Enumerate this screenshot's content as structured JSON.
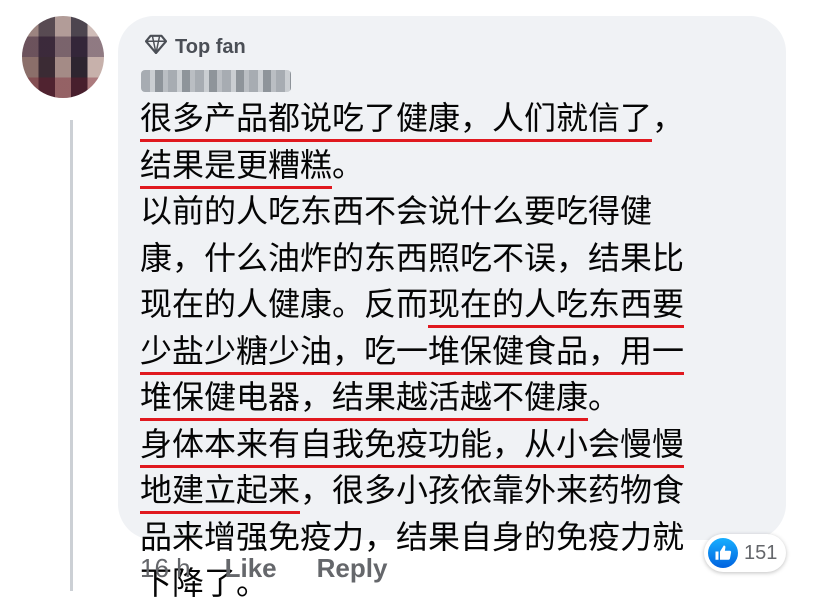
{
  "comment": {
    "badge_icon": "diamond-icon",
    "badge_label": "Top fan",
    "lines": [
      [
        {
          "t": "很多产品都说吃了健康，人们就信了",
          "u": true
        },
        {
          "t": "，",
          "u": false
        }
      ],
      [
        {
          "t": "结果是更糟糕",
          "u": true
        },
        {
          "t": "。",
          "u": false
        }
      ],
      [
        {
          "t": "以前的人吃东西不会说什么要吃得健",
          "u": false
        }
      ],
      [
        {
          "t": "康，什么油炸的东西照吃不误，结果比",
          "u": false
        }
      ],
      [
        {
          "t": "现在的人健康。反而",
          "u": false
        },
        {
          "t": "现在的人吃东西要",
          "u": true
        }
      ],
      [
        {
          "t": "少盐少糖少油，吃一堆保健食品，用一",
          "u": true
        }
      ],
      [
        {
          "t": "堆保健电器，结果越活越不健康",
          "u": true
        },
        {
          "t": "。",
          "u": false
        }
      ],
      [
        {
          "t": "身体本来有自我免疫功能，从小会慢慢",
          "u": true
        }
      ],
      [
        {
          "t": "地建立起来",
          "u": true
        },
        {
          "t": "，很多小孩依靠外来药物食",
          "u": false
        }
      ],
      [
        {
          "t": "品来增强免疫力，结果自身的免疫力就",
          "u": false
        }
      ],
      [
        {
          "t": "下降了。",
          "u": false
        }
      ]
    ]
  },
  "footer": {
    "time": "16 h",
    "like_label": "Like",
    "reply_label": "Reply"
  },
  "reactions": {
    "icon": "thumbs-up-icon",
    "count": "151",
    "color": "#1877f2"
  },
  "colors": {
    "underline": "#e0191f",
    "bubble": "#f0f2f5"
  }
}
